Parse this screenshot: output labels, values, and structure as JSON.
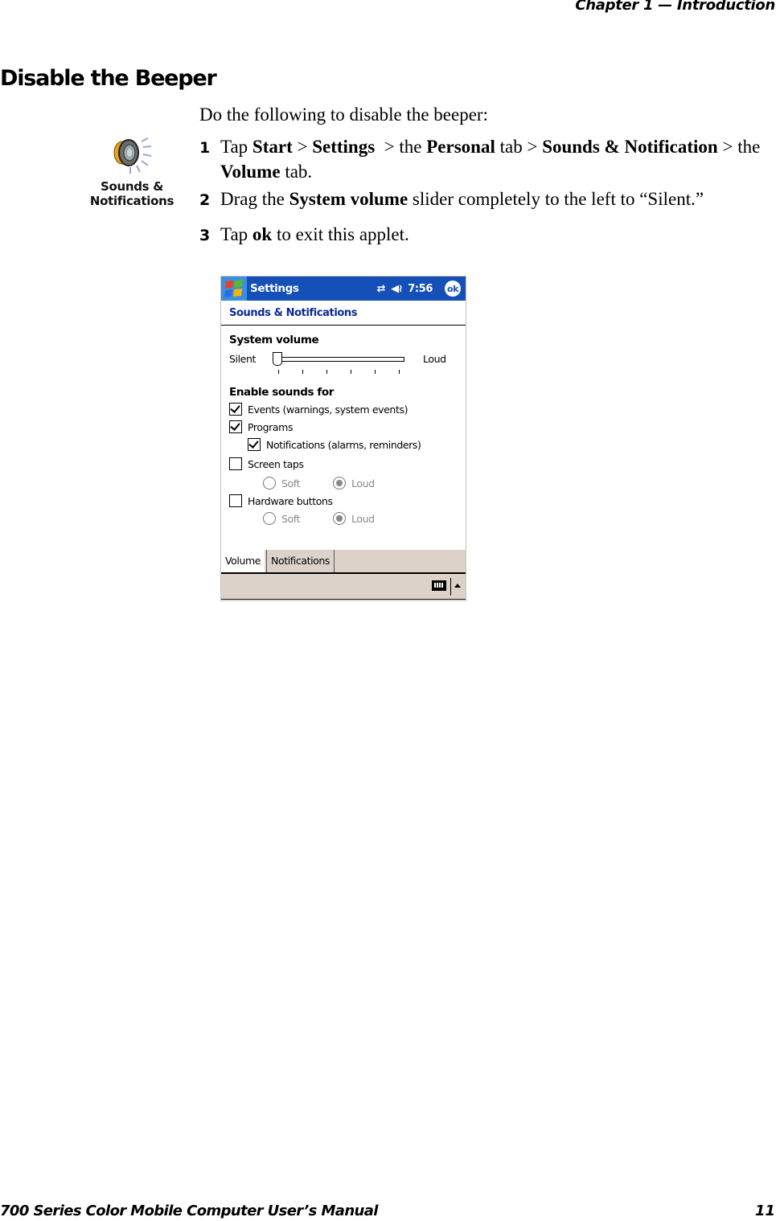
{
  "running_head": {
    "chapter": "Chapter 1",
    "dash": "—",
    "title": "Introduction"
  },
  "section_title": "Disable the Beeper",
  "intro": "Do the following to disable the beeper:",
  "applet_icon": {
    "icon": "speaker-icon",
    "label_line1": "Sounds &",
    "label_line2": "Notifications"
  },
  "steps": [
    {
      "num": "1",
      "parts": {
        "a": "Tap ",
        "b": "Start",
        "c": " > ",
        "d": "Settings",
        "e": "  > the ",
        "f": "Personal",
        "g": " tab > ",
        "h": "Sounds & Notification",
        "i": " > the",
        "j": "Volume",
        "k": " tab."
      }
    },
    {
      "num": "2",
      "parts": {
        "a": "Drag the ",
        "b": "System volume",
        "c": " slider completely to the left to “Silent.”"
      }
    },
    {
      "num": "3",
      "parts": {
        "a": "Tap ",
        "b": "ok",
        "c": " to exit this applet."
      }
    }
  ],
  "screenshot": {
    "titlebar": {
      "title": "Settings",
      "time": "7:56",
      "ok_label": "ok",
      "connectivity_icon": "sync-arrows-icon",
      "volume_icon": "speaker-icon"
    },
    "subtitle": "Sounds & Notifications",
    "system_volume": {
      "label": "System volume",
      "min_label": "Silent",
      "max_label": "Loud",
      "value_fraction": 0.0
    },
    "enable_sounds": {
      "label": "Enable sounds for",
      "items": [
        {
          "label": "Events (warnings, system events)",
          "checked": true
        },
        {
          "label": "Programs",
          "checked": true
        },
        {
          "label": "Notifications (alarms, reminders)",
          "checked": true
        },
        {
          "label": "Screen taps",
          "checked": false
        },
        {
          "label": "Hardware buttons",
          "checked": false
        }
      ],
      "screen_taps_options": {
        "soft": "Soft",
        "loud": "Loud",
        "selected": "Loud"
      },
      "hardware_buttons_options": {
        "soft": "Soft",
        "loud": "Loud",
        "selected": "Loud"
      }
    },
    "tabs": [
      {
        "label": "Volume",
        "active": true
      },
      {
        "label": "Notifications",
        "active": false
      }
    ],
    "menubar": {
      "keyboard_icon": "keyboard-icon",
      "arrow_icon": "up-arrow-icon"
    }
  },
  "footer": {
    "manual_title": "700 Series Color Mobile Computer User’s Manual",
    "page_number": "11"
  }
}
